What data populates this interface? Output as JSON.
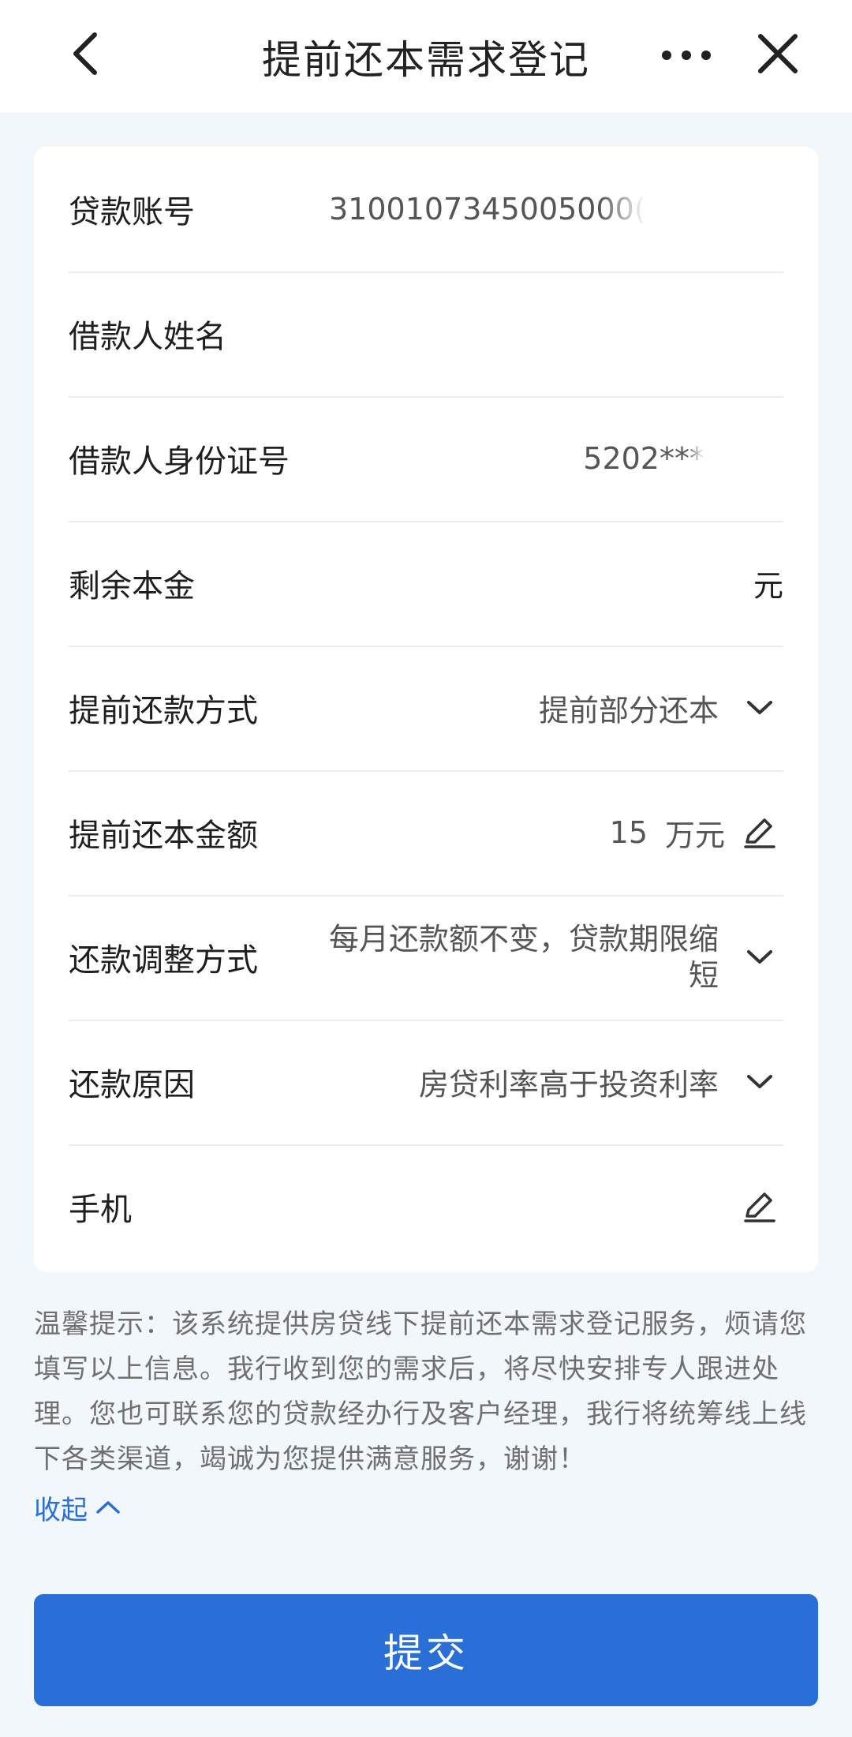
{
  "header": {
    "back_icon": "chevron-left-icon",
    "title": "提前还本需求登记",
    "more_icon": "more-horizontal-icon",
    "close_icon": "close-icon"
  },
  "form": {
    "loan_account": {
      "label": "贷款账号",
      "value": "3100107345005000("
    },
    "borrower_name": {
      "label": "借款人姓名",
      "value": ""
    },
    "borrower_id": {
      "label": "借款人身份证号",
      "value": "5202***"
    },
    "remaining_principal": {
      "label": "剩余本金",
      "value": "",
      "unit": "元"
    },
    "prepay_method": {
      "label": "提前还款方式",
      "value": "提前部分还本",
      "icon": "chevron-down-icon"
    },
    "prepay_amount": {
      "label": "提前还本金额",
      "value": "15",
      "unit": "万元",
      "icon": "edit-icon"
    },
    "adjust_method": {
      "label": "还款调整方式",
      "value": "每月还款额不变，贷款期限缩短",
      "icon": "chevron-down-icon"
    },
    "reason": {
      "label": "还款原因",
      "value": "房贷利率高于投资利率",
      "icon": "chevron-down-icon"
    },
    "phone": {
      "label": "手机",
      "value": "",
      "icon": "edit-icon"
    }
  },
  "notice": {
    "text": "温馨提示：该系统提供房贷线下提前还本需求登记服务，烦请您填写以上信息。我行收到您的需求后，将尽快安排专人跟进处理。您也可联系您的贷款经办行及客户经理，我行将统筹线上线下各类渠道，竭诚为您提供满意服务，谢谢！",
    "collapse_label": "收起",
    "collapse_icon": "chevron-up-icon"
  },
  "submit_label": "提交",
  "colors": {
    "primary": "#2a6fd8",
    "background": "#f1f7fa",
    "card": "#ffffff"
  }
}
